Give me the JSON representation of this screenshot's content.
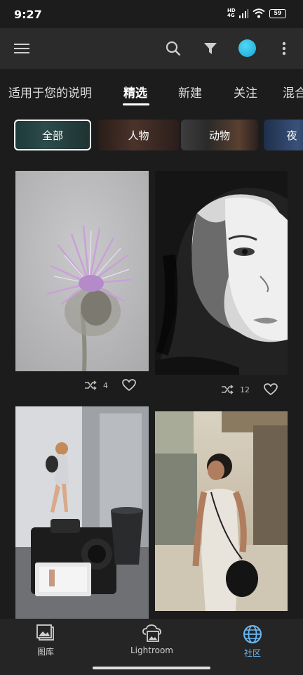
{
  "status": {
    "time": "9:27",
    "battery": "59"
  },
  "tabs": [
    {
      "label": "适用于您的说明"
    },
    {
      "label": "精选"
    },
    {
      "label": "新建"
    },
    {
      "label": "关注"
    },
    {
      "label": "混合"
    }
  ],
  "chips": [
    {
      "label": "全部"
    },
    {
      "label": "人物"
    },
    {
      "label": "动物"
    },
    {
      "label": "夜"
    }
  ],
  "cards": [
    {
      "remix_count": "4"
    },
    {
      "remix_count": "12"
    }
  ],
  "nav": {
    "library": "图库",
    "lightroom": "Lightroom",
    "community": "社区"
  },
  "colors": {
    "accent": "#6bb7f2",
    "avatar": "#2fc0e8"
  }
}
